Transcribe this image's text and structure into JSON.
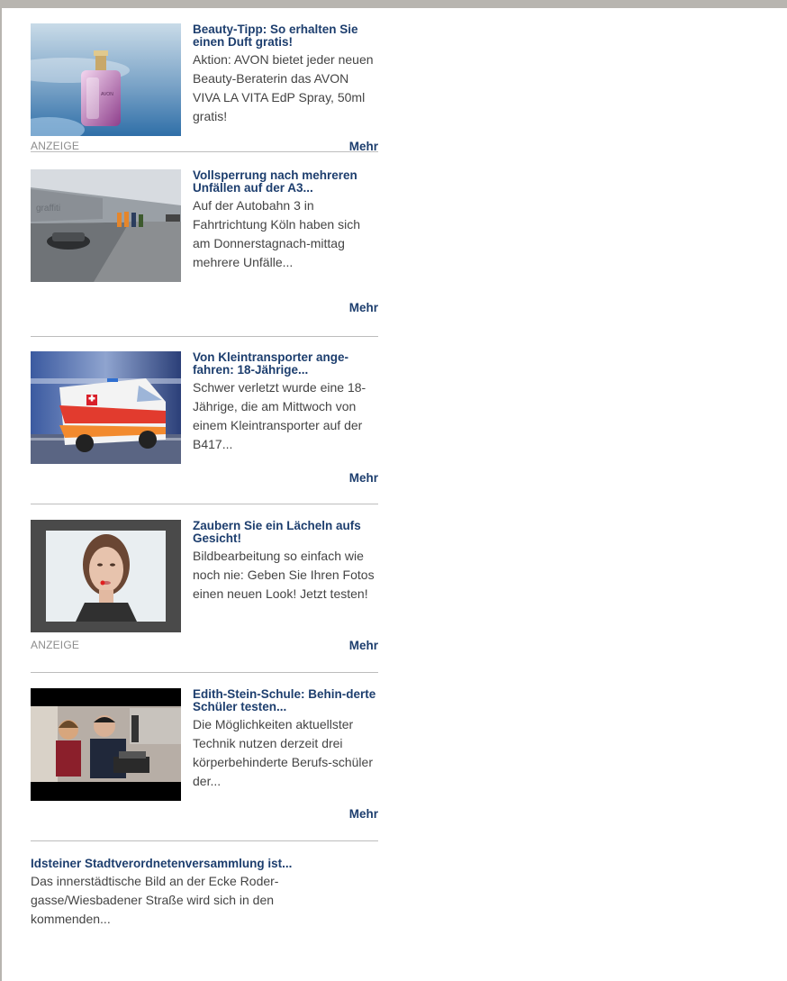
{
  "feed": {
    "items": [
      {
        "title": "Beauty-Tipp: So erhalten Sie einen Duft gratis!",
        "text": "Aktion: AVON bietet jeder neuen Beauty-Beraterin das AVON VIVA LA VITA EdP Spray, 50ml gratis!",
        "badge": "ANZEIGE",
        "more": "Mehr"
      },
      {
        "title": "Vollsperrung nach mehreren Unfällen auf der A3...",
        "text": "Auf der Autobahn 3 in Fahrtrichtung Köln haben sich am Donnerstagnach-mittag mehrere Unfälle...",
        "more": "Mehr"
      },
      {
        "title": "Von Kleintransporter ange-fahren: 18-Jährige...",
        "text": "Schwer verletzt wurde eine 18-Jährige, die am Mittwoch von einem Kleintransporter auf der B417...",
        "more": "Mehr"
      },
      {
        "title": "Zaubern Sie ein Lächeln aufs Gesicht!",
        "text": "Bildbearbeitung so einfach wie noch nie: Geben Sie Ihren Fotos einen neuen Look! Jetzt testen!",
        "badge": "ANZEIGE",
        "more": "Mehr"
      },
      {
        "title": "Edith-Stein-Schule: Behin-derte Schüler testen...",
        "text": "Die Möglichkeiten aktuellster Technik nutzen derzeit drei körperbehinderte Berufs-schüler der...",
        "more": "Mehr"
      },
      {
        "title": "Idsteiner Stadtverordnetenversammlung ist...",
        "text": "Das innerstädtische Bild an der Ecke Roder-gasse/Wiesbadener Straße wird sich in den kommenden..."
      }
    ]
  }
}
